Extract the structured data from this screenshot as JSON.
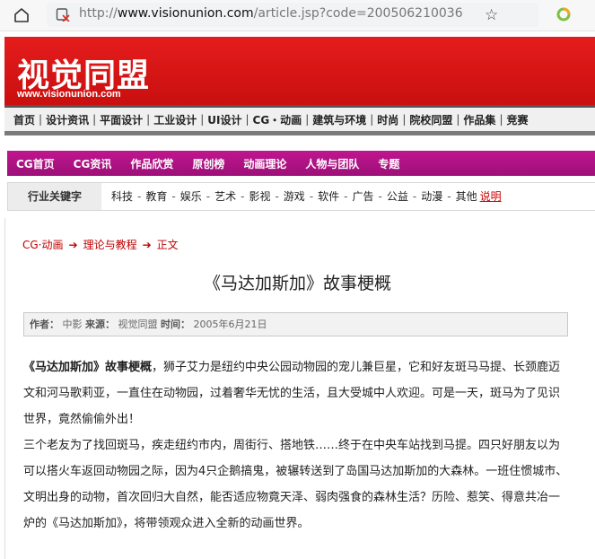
{
  "browser": {
    "url_proto": "http://",
    "url_host": "www.visionunion.com",
    "url_path": "/article.jsp?code=200506210036"
  },
  "header": {
    "logo_cn": "视觉同盟",
    "logo_url": "www.visionunion.com"
  },
  "main_nav": [
    "首页",
    "设计资讯",
    "平面设计",
    "工业设计",
    "UI设计",
    "CG・动画",
    "建筑与环境",
    "时尚",
    "院校同盟",
    "作品集",
    "竞赛"
  ],
  "sub_nav": [
    "CG首页",
    "CG资讯",
    "作品欣赏",
    "原创榜",
    "动画理论",
    "人物与团队",
    "专题"
  ],
  "keywords": {
    "label": "行业关键字",
    "items": [
      "科技",
      "教育",
      "娱乐",
      "艺术",
      "影视",
      "游戏",
      "软件",
      "广告",
      "公益",
      "动漫",
      "其他"
    ],
    "note": "说明"
  },
  "breadcrumb": {
    "items": [
      "CG·动画",
      "理论与教程",
      "正文"
    ],
    "arrow": "➔"
  },
  "article": {
    "title": "《马达加斯加》故事梗概",
    "meta": {
      "author_label": "作者：",
      "author": "中影",
      "source_label": "来源：",
      "source": "视觉同盟",
      "time_label": "时间：",
      "time": "2005年6月21日"
    },
    "lead_bold": "《马达加斯加》故事梗概",
    "para1": "，狮子艾力是纽约中央公园动物园的宠儿兼巨星，它和好友斑马马提、长颈鹿迈文和河马歌莉亚，一直住在动物园，过着奢华无忧的生活，且大受城中人欢迎。可是一天，斑马为了见识世界，竟然偷偷外出！",
    "para2": "三个老友为了找回斑马，疾走纽约市内，周街行、搭地铁……终于在中央车站找到马提。四只好朋友以为可以搭火车返回动物园之际，因为4只企鹅搞鬼，被辗转送到了岛国马达加斯加的大森林。一班住惯城市、文明出身的动物，首次回归大自然，能否适应物竟天泽、弱肉强食的森林生活？历险、惹笑、得意共冶一炉的《马达加斯加》，将带领观众进入全新的动画世界。"
  },
  "colors": {
    "header_red": "#d81414",
    "subnav_magenta": "#b0127f",
    "link_red": "#c00000"
  }
}
